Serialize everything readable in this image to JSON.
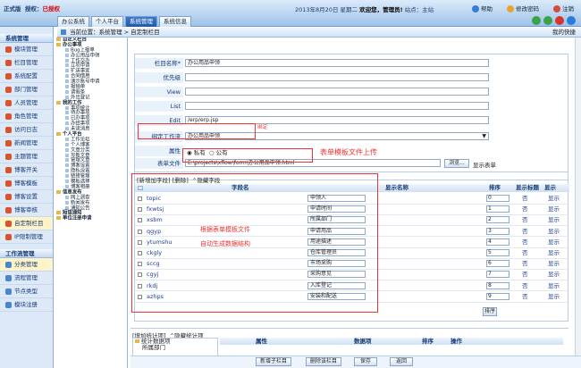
{
  "header": {
    "brand_version": "正式版",
    "brand_license_label": "授权：",
    "brand_license_value": "已授权",
    "date_text": "2013年8月20日 星期二",
    "welcome_text": "欢迎您，管理员!",
    "station_label": "站点：",
    "station_value": "主站",
    "help": "帮助",
    "change_password": "修改密码",
    "logout": "注销"
  },
  "tabs": [
    "办公系统",
    "个人平台",
    "系统管理",
    "系统信息"
  ],
  "active_tab_index": 2,
  "breadcrumb": {
    "prefix": "当前位置：",
    "path": "系统管理 > 自定制栏目",
    "right": "我的快捷"
  },
  "sidebar": {
    "section1": "系统管理",
    "items1": [
      "模块管理",
      "栏目管理",
      "系统配置",
      "部门管理",
      "人员管理",
      "角色管理",
      "访问日志",
      "新闻管理",
      "主题管理",
      "博客开关",
      "博客模板",
      "博客设置",
      "博客审核",
      "自定制栏目",
      "IP限制管理"
    ],
    "section2": "工作流管理",
    "items2": [
      "分类管理",
      "流程管理",
      "节点类型",
      "模块注册"
    ]
  },
  "tree": [
    {
      "level": 1,
      "text": "自定义栏目"
    },
    {
      "level": 1,
      "text": "办公事项"
    },
    {
      "level": 2,
      "text": "Bug上报单"
    },
    {
      "level": 2,
      "text": "办公用品申领"
    },
    {
      "level": 2,
      "text": "工作交办"
    },
    {
      "level": 2,
      "text": "立项申请"
    },
    {
      "level": 2,
      "text": "扩送事宜"
    },
    {
      "level": 2,
      "text": "合同借用"
    },
    {
      "level": 2,
      "text": "演示账号申请"
    },
    {
      "level": 2,
      "text": "报销单"
    },
    {
      "level": 2,
      "text": "请假条"
    },
    {
      "level": 2,
      "text": "外出登记"
    },
    {
      "level": 1,
      "text": "我的工作"
    },
    {
      "level": 2,
      "text": "事项统计"
    },
    {
      "level": 2,
      "text": "待办事项"
    },
    {
      "level": 2,
      "text": "已办事项"
    },
    {
      "level": 2,
      "text": "办结事项"
    },
    {
      "level": 2,
      "text": "未读消息"
    },
    {
      "level": 1,
      "text": "个人平台"
    },
    {
      "level": 2,
      "text": "工作论坛"
    },
    {
      "level": 2,
      "text": "个人博客"
    },
    {
      "level": 2,
      "text": "文章分类"
    },
    {
      "level": 2,
      "text": "写新文章"
    },
    {
      "level": 2,
      "text": "管理文章"
    },
    {
      "level": 2,
      "text": "博客设置"
    },
    {
      "level": 2,
      "text": "隐私设置"
    },
    {
      "level": 2,
      "text": "链接管理"
    },
    {
      "level": 2,
      "text": "模板选择"
    },
    {
      "level": 2,
      "text": "博客相册"
    },
    {
      "level": 1,
      "text": "信息发布"
    },
    {
      "level": 2,
      "text": "网上调查"
    },
    {
      "level": 2,
      "text": "新闻发布"
    },
    {
      "level": 2,
      "text": "通知公告"
    },
    {
      "level": 1,
      "text": "短信通知"
    },
    {
      "level": 1,
      "text": "单位注册申请"
    }
  ],
  "form": {
    "labels": {
      "name": "栏目名称*",
      "priority": "优先级",
      "view": "View",
      "list": "List",
      "edit": "Edit",
      "bind_flow": "绑定工作流",
      "attribute": "属性",
      "form_file": "表单文件"
    },
    "values": {
      "name": "办公用品申领",
      "priority": "",
      "view": "",
      "list": "",
      "edit": "/erp/erp.jsp",
      "bind_flow": "办公用品申领",
      "form_file": "E:\\projects\\xflow\\form\\办公用品申领.html"
    },
    "radio_private": "私有",
    "radio_public": "公有",
    "browse": "浏览...",
    "show_form": "显示表单",
    "bind_note": "绑定",
    "upload_note": "表单模板文件上传"
  },
  "fields": {
    "links": [
      "新增加字段",
      "删除",
      "隐藏字段"
    ],
    "headers": {
      "field_name": "字段名",
      "display_name": "显示名称",
      "sort": "排序",
      "show_title": "显示标题",
      "display": "显示"
    },
    "rows": [
      {
        "name": "topic",
        "title": "申领人",
        "sort": "0",
        "show": "否",
        "disp": "显示"
      },
      {
        "name": "fxwtsj",
        "title": "申请时间",
        "sort": "1",
        "show": "否",
        "disp": "显示"
      },
      {
        "name": "xsbm",
        "title": "所属部门",
        "sort": "2",
        "show": "否",
        "disp": "显示"
      },
      {
        "name": "qgyp",
        "title": "申请用品",
        "sort": "3",
        "show": "否",
        "disp": "显示"
      },
      {
        "name": "ytumshu",
        "title": "用途描述",
        "sort": "4",
        "show": "否",
        "disp": "显示"
      },
      {
        "name": "ckgly",
        "title": "仓库管理员",
        "sort": "5",
        "show": "否",
        "disp": "显示"
      },
      {
        "name": "sccg",
        "title": "市场采购",
        "sort": "6",
        "show": "否",
        "disp": "显示"
      },
      {
        "name": "cgyj",
        "title": "采购意见",
        "sort": "7",
        "show": "否",
        "disp": "显示"
      },
      {
        "name": "rkdj",
        "title": "入库登记",
        "sort": "8",
        "show": "否",
        "disp": "显示"
      },
      {
        "name": "azhps",
        "title": "安装和配送",
        "sort": "9",
        "show": "否",
        "disp": "显示"
      }
    ],
    "sort_button": "排序",
    "note1": "根据表单模板文件",
    "note2": "自动生成数据结构"
  },
  "stats": {
    "links": [
      "增加统计项",
      "隐藏统计项"
    ],
    "tree_root": "统计数据项",
    "tree_child": "所属部门",
    "headers": {
      "attribute": "属性",
      "data_item": "数据项",
      "sort": "排序",
      "action": "操作"
    }
  },
  "bottom_buttons": [
    "新增子栏目",
    "删除该栏目",
    "保存",
    "返回"
  ]
}
